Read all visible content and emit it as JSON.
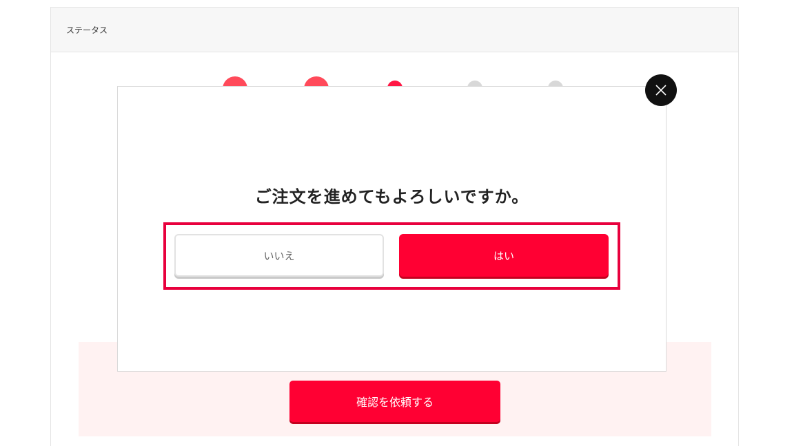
{
  "status_panel": {
    "header_label": "ステータス"
  },
  "progress": {
    "steps_total": 5,
    "steps": [
      {
        "state": "done",
        "icon": "checkmark-icon"
      },
      {
        "state": "done",
        "icon": "checkmark-icon"
      },
      {
        "state": "current"
      },
      {
        "state": "todo"
      },
      {
        "state": "todo"
      }
    ]
  },
  "confirm_area": {
    "request_button_label": "確認を依頼する"
  },
  "modal": {
    "title": "ご注文を進めてもよろしいですか。",
    "no_label": "いいえ",
    "yes_label": "はい",
    "close_icon": "close-icon"
  },
  "colors": {
    "accent": "#ff0033",
    "step_todo": "#d8d8d8",
    "highlight": "#e8003d",
    "confirm_area_bg": "#fff2f2"
  }
}
